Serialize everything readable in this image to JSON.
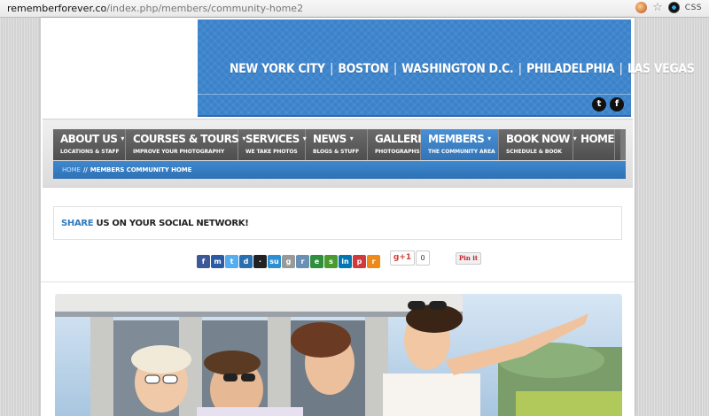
{
  "browser": {
    "url_domain": "rememberforever.co",
    "url_path": "/index.php/members/community-home2",
    "ext_label": "CSS"
  },
  "banner": {
    "cities": [
      "NEW YORK CITY",
      "BOSTON",
      "WASHINGTON D.C.",
      "PHILADELPHIA",
      "LAS VEGAS"
    ],
    "separator": "|",
    "social": [
      {
        "icon": "twitter-icon",
        "glyph": "t"
      },
      {
        "icon": "facebook-icon",
        "glyph": "f"
      }
    ]
  },
  "nav": {
    "items": [
      {
        "label": "ABOUT US",
        "sub": "LOCATIONS & STAFF",
        "dropdown": true,
        "active": false
      },
      {
        "label": "COURSES & TOURS",
        "sub": "IMPROVE YOUR PHOTOGRAPHY",
        "dropdown": true,
        "active": false
      },
      {
        "label": "SERVICES",
        "sub": "WE TAKE PHOTOS",
        "dropdown": true,
        "active": false
      },
      {
        "label": "NEWS",
        "sub": "BLOGS & STUFF",
        "dropdown": true,
        "active": false
      },
      {
        "label": "GALLERIES",
        "sub": "PHOTOGRAPHS",
        "dropdown": false,
        "active": false
      },
      {
        "label": "MEMBERS",
        "sub": "THE COMMUNITY AREA",
        "dropdown": true,
        "active": true
      },
      {
        "label": "BOOK NOW",
        "sub": "SCHEDULE & BOOK",
        "dropdown": true,
        "active": false
      },
      {
        "label": "HOME",
        "sub": "",
        "dropdown": false,
        "active": false
      }
    ],
    "chevron": "▾"
  },
  "breadcrumb": {
    "home": "HOME",
    "separator": "//",
    "current": "MEMBERS COMMUNITY HOME"
  },
  "share": {
    "keyword": "SHARE",
    "rest": " US ON YOUR SOCIAL NETWORK!",
    "icons": [
      {
        "name": "facebook-share-icon",
        "color": "#3b5998",
        "glyph": "f"
      },
      {
        "name": "myspace-share-icon",
        "color": "#2b5aa6",
        "glyph": "m"
      },
      {
        "name": "twitter-share-icon",
        "color": "#55acee",
        "glyph": "t"
      },
      {
        "name": "digg-share-icon",
        "color": "#2a6fb0",
        "glyph": "d"
      },
      {
        "name": "delicious-share-icon",
        "color": "#222222",
        "glyph": "·"
      },
      {
        "name": "stumbleupon-share-icon",
        "color": "#2c8fd4",
        "glyph": "su"
      },
      {
        "name": "google-share-icon",
        "color": "#999999",
        "glyph": "g"
      },
      {
        "name": "reddit-share-icon",
        "color": "#6a8fb5",
        "glyph": "r"
      },
      {
        "name": "evernote-share-icon",
        "color": "#2f8f3c",
        "glyph": "e"
      },
      {
        "name": "share-icon",
        "color": "#4a9a2f",
        "glyph": "s"
      },
      {
        "name": "linkedin-share-icon",
        "color": "#0077b5",
        "glyph": "in"
      },
      {
        "name": "pinterest-share-icon",
        "color": "#d13a3a",
        "glyph": "p"
      },
      {
        "name": "rss-share-icon",
        "color": "#ee8a1a",
        "glyph": "r"
      }
    ],
    "gplus_label": "g+1",
    "gplus_count": "0",
    "pinit_label": "Pin it"
  }
}
